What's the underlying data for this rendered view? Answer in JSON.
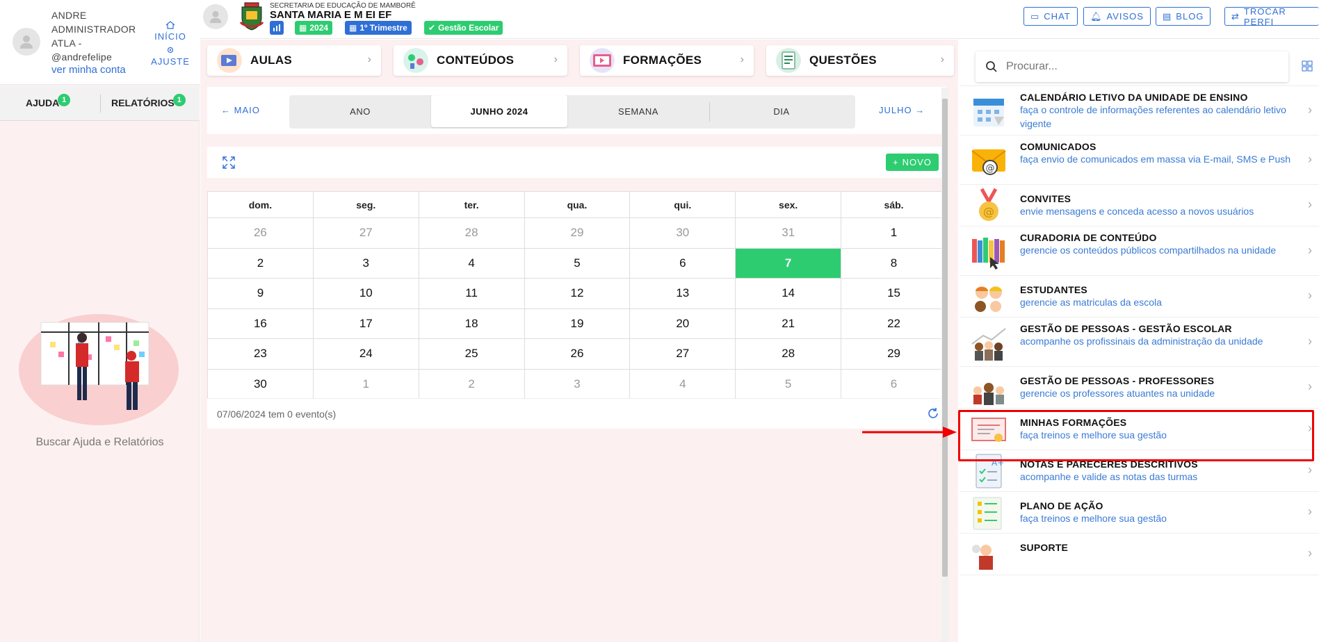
{
  "user": {
    "name_line1": "ANDRE",
    "name_line2": "ADMINISTRADOR",
    "name_line3": "ATLA -",
    "handle": "@andrefelipe",
    "account_link": "ver minha conta"
  },
  "sidebar": {
    "home_label": "INÍCIO",
    "settings_label": "AJUSTE",
    "tabs": [
      {
        "label": "AJUDA",
        "badge": "1"
      },
      {
        "label": "RELATÓRIOS",
        "badge": "1"
      }
    ],
    "help_caption": "Buscar Ajuda e Relatórios"
  },
  "header": {
    "org_line": "SECRETARIA DE EDUCAÇÃO DE MAMBORÊ",
    "school_name": "SANTA MARIA E M EI EF",
    "tags": [
      {
        "label": "2024"
      },
      {
        "label": "1º Trimestre"
      },
      {
        "label": "Gestão Escolar"
      }
    ],
    "buttons": [
      {
        "label": "CHAT"
      },
      {
        "label": "AVISOS"
      },
      {
        "label": "BLOG"
      },
      {
        "label": "TROCAR PERFI"
      }
    ]
  },
  "categories": [
    {
      "label": "AULAS"
    },
    {
      "label": "CONTEÚDOS"
    },
    {
      "label": "FORMAÇÕES"
    },
    {
      "label": "QUESTÕES"
    }
  ],
  "calendar_nav": {
    "prev": "MAIO",
    "next": "JULHO",
    "views": [
      "ANO",
      "JUNHO 2024",
      "SEMANA",
      "DIA"
    ],
    "active_view": "JUNHO 2024"
  },
  "toolbar": {
    "new_label": "NOVO"
  },
  "calendar": {
    "weekdays": [
      "dom.",
      "seg.",
      "ter.",
      "qua.",
      "qui.",
      "sex.",
      "sáb."
    ],
    "weeks": [
      [
        "26",
        "27",
        "28",
        "29",
        "30",
        "31",
        "1"
      ],
      [
        "2",
        "3",
        "4",
        "5",
        "6",
        "7",
        "8"
      ],
      [
        "9",
        "10",
        "11",
        "12",
        "13",
        "14",
        "15"
      ],
      [
        "16",
        "17",
        "18",
        "19",
        "20",
        "21",
        "22"
      ],
      [
        "23",
        "24",
        "25",
        "26",
        "27",
        "28",
        "29"
      ],
      [
        "30",
        "1",
        "2",
        "3",
        "4",
        "5",
        "6"
      ]
    ],
    "today": "7",
    "footer_text": "07/06/2024 tem 0 evento(s)"
  },
  "search": {
    "placeholder": "Procurar..."
  },
  "menu": [
    {
      "title": "CALENDÁRIO LETIVO DA UNIDADE DE ENSINO",
      "desc": "faça o controle de informações referentes ao calendário letivo vigente",
      "icon": "calendar-icon"
    },
    {
      "title": "COMUNICADOS",
      "desc": "faça envio de comunicados em massa via E-mail, SMS e Push",
      "icon": "envelope-icon"
    },
    {
      "title": "CONVITES",
      "desc": "envie mensagens e conceda acesso a novos usuários",
      "icon": "medal-icon"
    },
    {
      "title": "CURADORIA DE CONTEÚDO",
      "desc": "gerencie os conteúdos públicos compartilhados na unidade",
      "icon": "books-icon"
    },
    {
      "title": "ESTUDANTES",
      "desc": "gerencie as matriculas da escola",
      "icon": "students-icon"
    },
    {
      "title": "GESTÃO DE PESSOAS - GESTÃO ESCOLAR",
      "desc": "acompanhe os profissinais da administração da unidade",
      "icon": "people-chart-icon"
    },
    {
      "title": "GESTÃO DE PESSOAS - PROFESSORES",
      "desc": "gerencie os professores atuantes na unidade",
      "icon": "teachers-icon"
    },
    {
      "title": "MINHAS FORMAÇÕES",
      "desc": "faça treinos e melhore sua gestão",
      "icon": "certificate-icon"
    },
    {
      "title": "NOTAS E PARECERES DESCRITIVOS",
      "desc": "acompanhe e valide as notas das turmas",
      "icon": "grades-icon"
    },
    {
      "title": "PLANO DE AÇÃO",
      "desc": "faça treinos e melhore sua gestão",
      "icon": "checklist-icon"
    },
    {
      "title": "SUPORTE",
      "desc": "",
      "icon": "support-icon"
    }
  ],
  "colors": {
    "accent": "#2f6fd6",
    "green": "#2ecc71",
    "highlight": "#e00000"
  }
}
